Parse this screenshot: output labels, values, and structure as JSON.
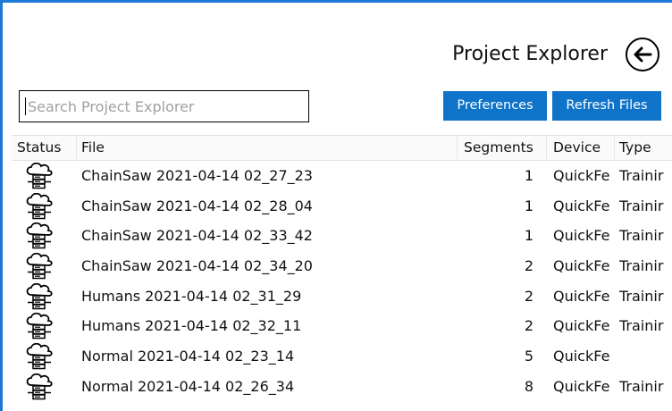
{
  "page": {
    "title": "Project Explorer",
    "back_icon": "arrow-left-icon"
  },
  "search": {
    "placeholder": "Search Project Explorer",
    "value": ""
  },
  "toolbar": {
    "preferences_label": "Preferences",
    "refresh_label": "Refresh Files"
  },
  "colors": {
    "accent": "#0f73c9",
    "window_border": "#1c78d4"
  },
  "table": {
    "columns": {
      "status": "Status",
      "file": "File",
      "segments": "Segments",
      "device": "Device",
      "type": "Type"
    },
    "rows": [
      {
        "status_icon": "cloud-server-icon",
        "file": "ChainSaw 2021-04-14 02_27_23",
        "segments": "1",
        "device": "QuickFe",
        "type": "Trainir"
      },
      {
        "status_icon": "cloud-server-icon",
        "file": "ChainSaw 2021-04-14 02_28_04",
        "segments": "1",
        "device": "QuickFe",
        "type": "Trainir"
      },
      {
        "status_icon": "cloud-server-icon",
        "file": "ChainSaw 2021-04-14 02_33_42",
        "segments": "1",
        "device": "QuickFe",
        "type": "Trainir"
      },
      {
        "status_icon": "cloud-server-icon",
        "file": "ChainSaw 2021-04-14 02_34_20",
        "segments": "2",
        "device": "QuickFe",
        "type": "Trainir"
      },
      {
        "status_icon": "cloud-server-icon",
        "file": "Humans 2021-04-14 02_31_29",
        "segments": "2",
        "device": "QuickFe",
        "type": "Trainir"
      },
      {
        "status_icon": "cloud-server-icon",
        "file": "Humans 2021-04-14 02_32_11",
        "segments": "2",
        "device": "QuickFe",
        "type": "Trainir"
      },
      {
        "status_icon": "cloud-server-icon",
        "file": "Normal 2021-04-14 02_23_14",
        "segments": "5",
        "device": "QuickFe",
        "type": ""
      },
      {
        "status_icon": "cloud-server-icon",
        "file": "Normal 2021-04-14 02_26_34",
        "segments": "8",
        "device": "QuickFe",
        "type": "Trainir"
      }
    ]
  }
}
